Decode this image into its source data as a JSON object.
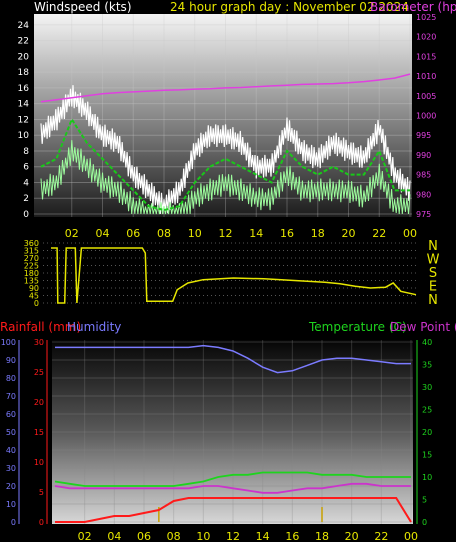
{
  "header": {
    "windspeed_label": "Windspeed (kts)",
    "title": "24 hour graph day : November 02 2024",
    "barometer_label": "Barometer (hpa)"
  },
  "colors": {
    "wind": "#ffffff",
    "wind_avg": "#19c819",
    "wind_range": "#9dfc9d",
    "barometer": "#e040e0",
    "direction": "#e6e600",
    "rainfall": "#ff1a1a",
    "rain_rate": "#c8a000",
    "humidity": "#7b7bff",
    "temperature": "#1ed41e",
    "dew_point": "#cc33cc",
    "compass": "#e6e600"
  },
  "x_ticks": [
    "02",
    "04",
    "06",
    "08",
    "10",
    "12",
    "14",
    "16",
    "18",
    "20",
    "22",
    "00"
  ],
  "compass": [
    "N",
    "W",
    "S",
    "E",
    "N"
  ],
  "chart_data": [
    {
      "type": "line",
      "panel": "wind_barometer",
      "ylim_left": [
        0,
        25
      ],
      "yticks_left": [
        "0",
        "2",
        "4",
        "6",
        "8",
        "10",
        "12",
        "14",
        "16",
        "18",
        "20",
        "22",
        "24"
      ],
      "ylim_right": [
        975,
        1025
      ],
      "yticks_right": [
        "975",
        "980",
        "985",
        "990",
        "995",
        "1000",
        "1005",
        "1010",
        "1015",
        "1020",
        "1025"
      ],
      "x_hours": [
        0,
        1,
        2,
        3,
        4,
        5,
        6,
        7,
        8,
        9,
        10,
        11,
        12,
        13,
        14,
        15,
        16,
        17,
        18,
        19,
        20,
        21,
        22,
        23,
        24
      ],
      "series": [
        {
          "name": "Windspeed (kts)",
          "values": [
            10,
            12,
            15,
            13,
            10,
            9,
            5,
            3,
            1,
            3,
            8,
            10,
            10,
            9,
            6,
            6,
            11,
            8,
            7,
            9,
            8,
            7,
            11,
            5,
            3
          ]
        },
        {
          "name": "avg",
          "values": [
            6,
            7,
            12,
            9,
            7,
            5,
            3,
            1,
            0.5,
            1,
            4,
            6,
            7,
            6,
            5,
            4,
            8,
            6,
            5,
            6,
            5,
            5,
            8,
            3,
            3
          ]
        },
        {
          "name": "gust low",
          "values": [
            3,
            4,
            8,
            6,
            4,
            3,
            1,
            0,
            0,
            0,
            2,
            3,
            4,
            3,
            2,
            2,
            5,
            3,
            3,
            3,
            3,
            2,
            5,
            1,
            1
          ]
        },
        {
          "name": "Barometer (hpa)",
          "values": [
            1003.5,
            1004,
            1004.5,
            1005,
            1005.5,
            1005.8,
            1006,
            1006.2,
            1006.4,
            1006.5,
            1006.7,
            1006.8,
            1007,
            1007.1,
            1007.3,
            1007.5,
            1007.7,
            1007.9,
            1008,
            1008.1,
            1008.3,
            1008.6,
            1009,
            1009.5,
            1010.5
          ]
        }
      ]
    },
    {
      "type": "line",
      "panel": "wind_direction",
      "ylim": [
        0,
        360
      ],
      "yticks": [
        "0",
        "45",
        "90",
        "135",
        "180",
        "225",
        "270",
        "315",
        "360"
      ],
      "x_hours": [
        0,
        0.4,
        0.45,
        0.9,
        1.0,
        1.6,
        1.7,
        2,
        4,
        6,
        6.2,
        6.3,
        7,
        8,
        8.3,
        9,
        10,
        12,
        14,
        16,
        18,
        19,
        20,
        21,
        22,
        22.5,
        23,
        24
      ],
      "values": [
        330,
        330,
        0,
        0,
        330,
        330,
        0,
        330,
        330,
        330,
        300,
        10,
        10,
        10,
        80,
        120,
        140,
        150,
        145,
        135,
        125,
        115,
        100,
        90,
        95,
        120,
        70,
        50
      ]
    },
    {
      "type": "line",
      "panel": "rain_humidity_temperature",
      "yticks_rainfall": [
        "0",
        "5",
        "10",
        "15",
        "20",
        "25",
        "30"
      ],
      "ylim_rainfall": [
        0,
        30
      ],
      "yticks_humidity": [
        "0",
        "10",
        "20",
        "30",
        "40",
        "50",
        "60",
        "70",
        "80",
        "90",
        "100"
      ],
      "ylim_humidity": [
        0,
        100
      ],
      "yticks_temperature": [
        "0",
        "5",
        "10",
        "15",
        "20",
        "25",
        "30",
        "35",
        "40"
      ],
      "ylim_temperature": [
        0,
        40
      ],
      "labels": {
        "rainfall": "Rainfall (mm)",
        "humidity": "Humidity",
        "temperature": "Temperature (C)",
        "dew_point": "Dew Point (C)"
      },
      "x_hours": [
        0,
        1,
        2,
        3,
        4,
        5,
        6,
        7,
        8,
        9,
        10,
        11,
        12,
        13,
        14,
        15,
        16,
        17,
        18,
        19,
        20,
        21,
        22,
        23,
        24
      ],
      "series": [
        {
          "name": "Humidity",
          "values": [
            97,
            97,
            97,
            97,
            97,
            97,
            97,
            97,
            97,
            97,
            98,
            97,
            95,
            91,
            86,
            83,
            84,
            87,
            90,
            91,
            91,
            90,
            89,
            88,
            88
          ]
        },
        {
          "name": "Temperature (C)",
          "values": [
            9,
            8.5,
            8,
            8,
            8,
            8,
            8,
            8,
            8,
            8.5,
            9,
            10,
            10.5,
            10.5,
            11,
            11,
            11,
            11,
            10.5,
            10.5,
            10.5,
            10,
            10,
            10,
            10
          ]
        },
        {
          "name": "Dew Point (C)",
          "values": [
            8,
            7.5,
            7.5,
            7.5,
            7.5,
            7.5,
            7.5,
            7.5,
            7.5,
            7.5,
            8,
            8,
            7.5,
            7,
            6.5,
            6.5,
            7,
            7.5,
            7.5,
            8,
            8.5,
            8.5,
            8,
            8,
            8
          ]
        },
        {
          "name": "Rainfall (mm)",
          "values": [
            0,
            0,
            0,
            0.5,
            1,
            1,
            1.5,
            2,
            3.5,
            4,
            4,
            4,
            4,
            4,
            4,
            4,
            4,
            4,
            4,
            4,
            4,
            4,
            4,
            4,
            0
          ]
        }
      ],
      "rain_bars": [
        {
          "hour": 7,
          "value": 2.5
        },
        {
          "hour": 18,
          "value": 2.5
        }
      ]
    }
  ]
}
